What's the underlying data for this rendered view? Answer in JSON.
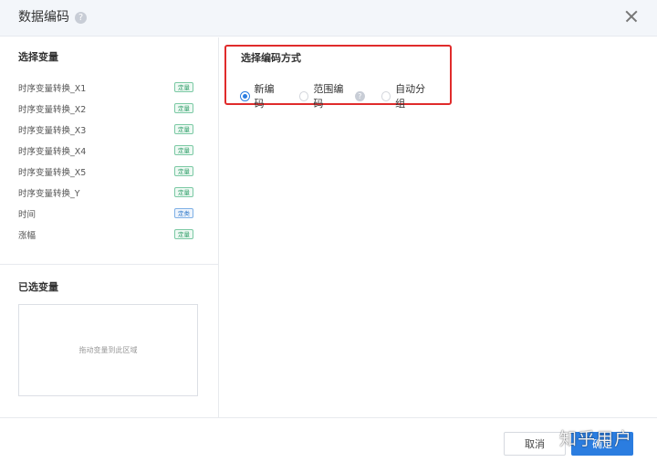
{
  "dialog": {
    "title": "数据编码",
    "help_icon": "?"
  },
  "left": {
    "select_title": "选择变量",
    "variables": [
      {
        "name": "时序变量转换_X1",
        "tag": "定量"
      },
      {
        "name": "时序变量转换_X2",
        "tag": "定量"
      },
      {
        "name": "时序变量转换_X3",
        "tag": "定量"
      },
      {
        "name": "时序变量转换_X4",
        "tag": "定量"
      },
      {
        "name": "时序变量转换_X5",
        "tag": "定量"
      },
      {
        "name": "时序变量转换_Y",
        "tag": "定量"
      },
      {
        "name": "时间",
        "tag": "定类"
      },
      {
        "name": "涨幅",
        "tag": "定量"
      }
    ],
    "selected_title": "已选变量",
    "drop_hint": "拖动变量到此区域"
  },
  "encoding": {
    "title": "选择编码方式",
    "options": [
      {
        "label": "新编码",
        "checked": true
      },
      {
        "label": "范围编码",
        "help": "?",
        "checked": false
      },
      {
        "label": "自动分组",
        "checked": false
      }
    ]
  },
  "footer": {
    "cancel_label": "取消",
    "confirm_label": "确定"
  },
  "watermark": "知乎用户",
  "colors": {
    "accent": "#2b7de0",
    "highlight_border": "#e02b2b",
    "tag_green": "#2e9d68",
    "tag_blue": "#2f78c8"
  }
}
